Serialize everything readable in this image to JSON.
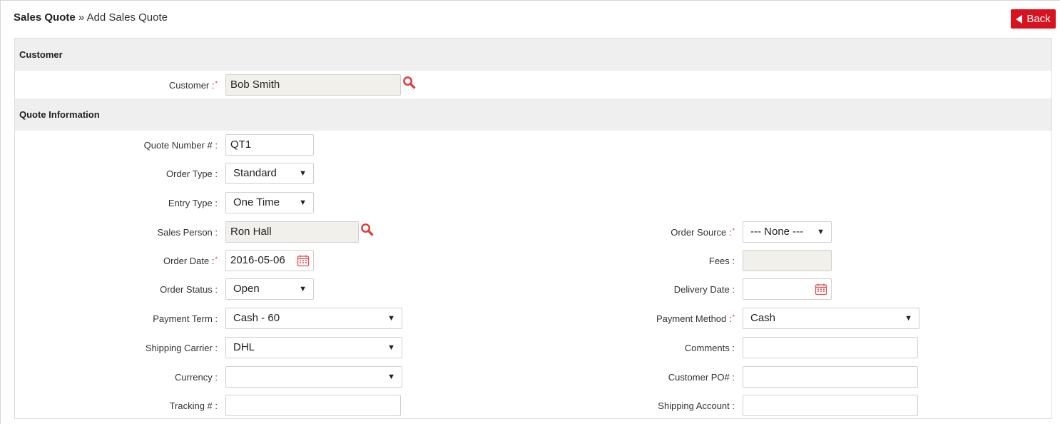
{
  "breadcrumb": {
    "root": "Sales Quote",
    "separator": "»",
    "current": "Add Sales Quote"
  },
  "back_button": {
    "label": "Back"
  },
  "sections": {
    "customer": "Customer",
    "quote_info": "Quote Information"
  },
  "required_marker": "*",
  "colors": {
    "accent": "#d9121f",
    "required": "#e23b3b",
    "readonly_bg": "#f1f0ea"
  },
  "fields": {
    "customer": {
      "label": "Customer :",
      "value": "Bob Smith"
    },
    "quote_number": {
      "label": "Quote Number # :",
      "value": "QT1"
    },
    "order_type": {
      "label": "Order Type :",
      "value": "Standard"
    },
    "entry_type": {
      "label": "Entry Type :",
      "value": "One Time"
    },
    "sales_person": {
      "label": "Sales Person :",
      "value": "Ron Hall"
    },
    "order_date": {
      "label": "Order Date :",
      "value": "2016-05-06"
    },
    "order_status": {
      "label": "Order Status :",
      "value": "Open"
    },
    "payment_term": {
      "label": "Payment Term :",
      "value": "Cash - 60"
    },
    "shipping_carrier": {
      "label": "Shipping Carrier :",
      "value": "DHL"
    },
    "currency": {
      "label": "Currency :",
      "value": ""
    },
    "tracking": {
      "label": "Tracking # :",
      "value": ""
    },
    "order_source": {
      "label": "Order Source :",
      "value": "--- None ---"
    },
    "fees": {
      "label": "Fees :",
      "value": ""
    },
    "delivery_date": {
      "label": "Delivery Date :",
      "value": ""
    },
    "payment_method": {
      "label": "Payment Method :",
      "value": "Cash"
    },
    "comments": {
      "label": "Comments :",
      "value": ""
    },
    "customer_po": {
      "label": "Customer PO# :",
      "value": ""
    },
    "shipping_account": {
      "label": "Shipping Account :",
      "value": ""
    }
  }
}
